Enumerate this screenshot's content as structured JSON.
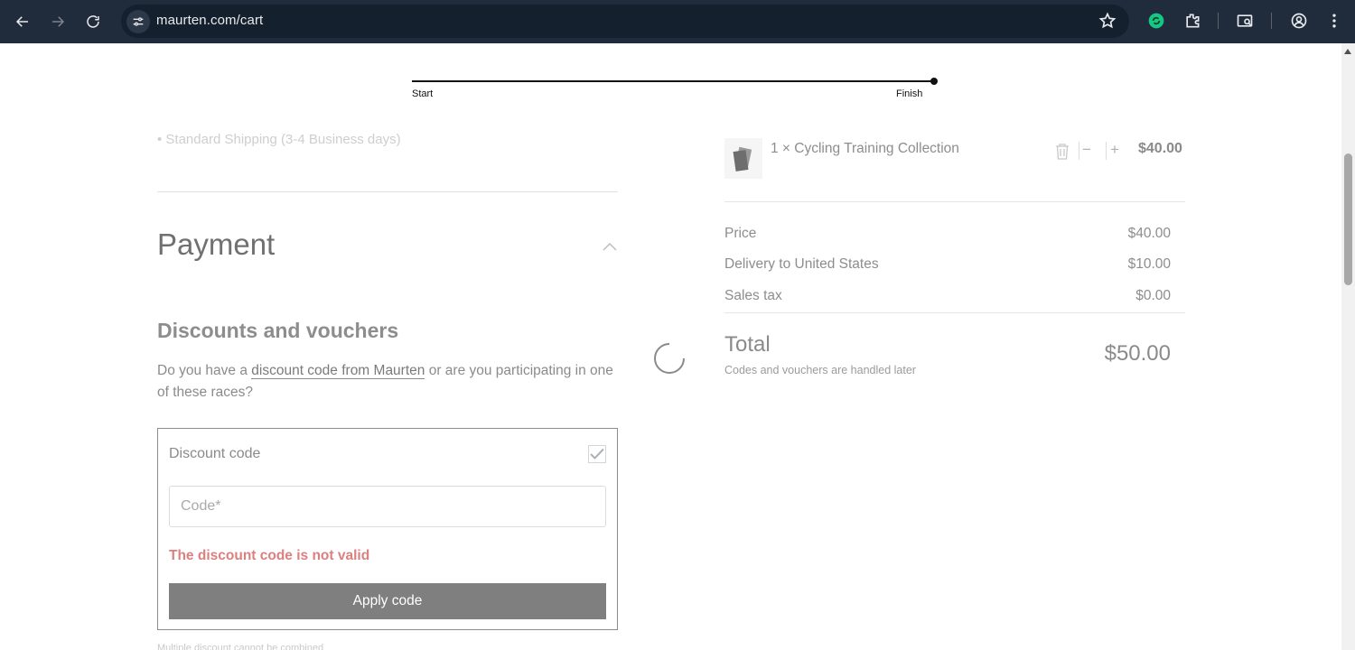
{
  "browser": {
    "url": "maurten.com/cart"
  },
  "progress": {
    "start_label": "Start",
    "finish_label": "Finish"
  },
  "shipping": {
    "faded_option": "• Standard Shipping (3-4 Business days)"
  },
  "payment": {
    "title": "Payment"
  },
  "discounts": {
    "title": "Discounts and vouchers",
    "text_before_link": "Do you have a ",
    "link_text": "discount code from Maurten",
    "text_after_link": " or are you participating in one of these races?",
    "box_label": "Discount code",
    "input_placeholder": "Code*",
    "input_value": "",
    "error": "The discount code is not valid",
    "apply_label": "Apply code",
    "below_faded": "Multiple discount cannot be combined"
  },
  "cart": {
    "item": {
      "quantity_name": "1 × Cycling Training Collection",
      "price": "$40.00"
    },
    "summary": [
      {
        "label": "Price",
        "value": "$40.00"
      },
      {
        "label": "Delivery to United States",
        "value": "$10.00"
      },
      {
        "label": "Sales tax",
        "value": "$0.00"
      }
    ],
    "total_label": "Total",
    "total_note": "Codes and vouchers are handled later",
    "total_value": "$50.00"
  },
  "colors": {
    "chrome_bg": "#202b3c",
    "error": "#dc7f7f",
    "apply_button": "#7f7f7f"
  }
}
